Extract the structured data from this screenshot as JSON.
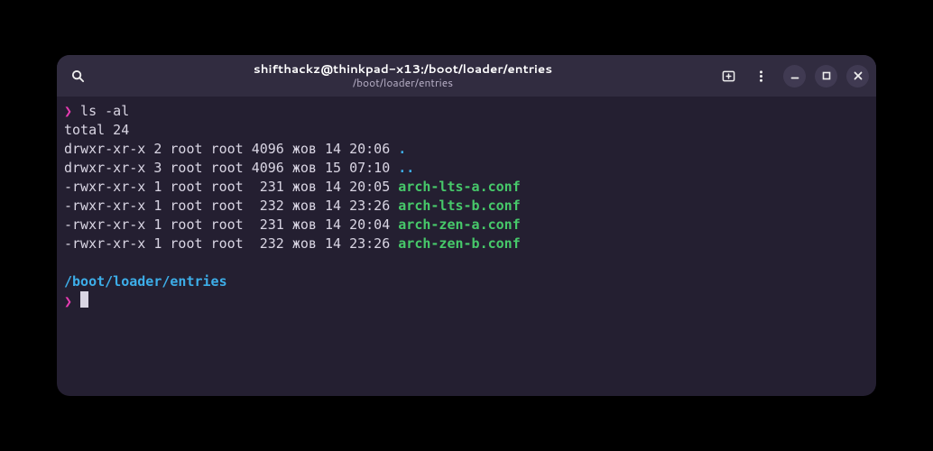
{
  "window": {
    "title": "shifthackz@thinkpad-x13:/boot/loader/entries",
    "subtitle": "/boot/loader/entries"
  },
  "prompt": {
    "symbol": "❯",
    "command": "ls -al",
    "cwd": "/boot/loader/entries"
  },
  "output": {
    "total_line": "total 24",
    "entries": [
      {
        "perms": "drwxr-xr-x",
        "links": "2",
        "user": "root",
        "group": "root",
        "size": "4096",
        "date": "жов 14 20:06",
        "name": ".",
        "kind": "dir"
      },
      {
        "perms": "drwxr-xr-x",
        "links": "3",
        "user": "root",
        "group": "root",
        "size": "4096",
        "date": "жов 15 07:10",
        "name": "..",
        "kind": "dir"
      },
      {
        "perms": "-rwxr-xr-x",
        "links": "1",
        "user": "root",
        "group": "root",
        "size": " 231",
        "date": "жов 14 20:05",
        "name": "arch-lts-a.conf",
        "kind": "exec"
      },
      {
        "perms": "-rwxr-xr-x",
        "links": "1",
        "user": "root",
        "group": "root",
        "size": " 232",
        "date": "жов 14 23:26",
        "name": "arch-lts-b.conf",
        "kind": "exec"
      },
      {
        "perms": "-rwxr-xr-x",
        "links": "1",
        "user": "root",
        "group": "root",
        "size": " 231",
        "date": "жов 14 20:04",
        "name": "arch-zen-a.conf",
        "kind": "exec"
      },
      {
        "perms": "-rwxr-xr-x",
        "links": "1",
        "user": "root",
        "group": "root",
        "size": " 232",
        "date": "жов 14 23:26",
        "name": "arch-zen-b.conf",
        "kind": "exec"
      }
    ]
  },
  "icons": {
    "search": "search-icon",
    "new_tab": "new-tab-icon",
    "menu": "menu-icon",
    "minimize": "minimize-icon",
    "maximize": "maximize-icon",
    "close": "close-icon"
  },
  "colors": {
    "bg": "#241f31",
    "titlebar": "#312c40",
    "prompt": "#e63bb2",
    "dir": "#3daee9",
    "exec": "#47c96a",
    "text": "#d9d5e3"
  }
}
